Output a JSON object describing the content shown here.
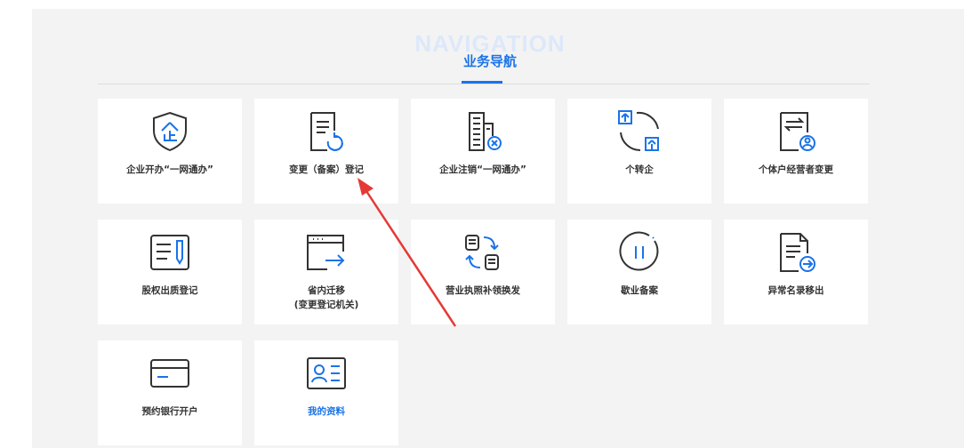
{
  "header": {
    "bg_text": "NAVIGATION",
    "title": "业务导航"
  },
  "colors": {
    "accent": "#1a73e8",
    "arrow": "#e53935",
    "icon_stroke": "#333333"
  },
  "cards": [
    {
      "label": "企业开办“一网通办”",
      "icon": "shield-enterprise-icon"
    },
    {
      "label": "变更（备案）登记",
      "icon": "document-refresh-icon"
    },
    {
      "label": "企业注销“一网通办”",
      "icon": "building-cancel-icon"
    },
    {
      "label": "个转企",
      "icon": "individual-to-enterprise-icon"
    },
    {
      "label": "个体户经营者变更",
      "icon": "document-user-swap-icon"
    },
    {
      "label": "股权出质登记",
      "icon": "document-pen-icon"
    },
    {
      "label": "省内迁移\n(变更登记机关)",
      "icon": "browser-move-icon"
    },
    {
      "label": "营业执照补领换发",
      "icon": "document-exchange-icon"
    },
    {
      "label": "歇业备案",
      "icon": "pause-circle-icon"
    },
    {
      "label": "异常名录移出",
      "icon": "document-export-icon"
    },
    {
      "label": "预约银行开户",
      "icon": "bank-card-icon"
    },
    {
      "label": "我的资料",
      "icon": "id-card-icon"
    }
  ]
}
